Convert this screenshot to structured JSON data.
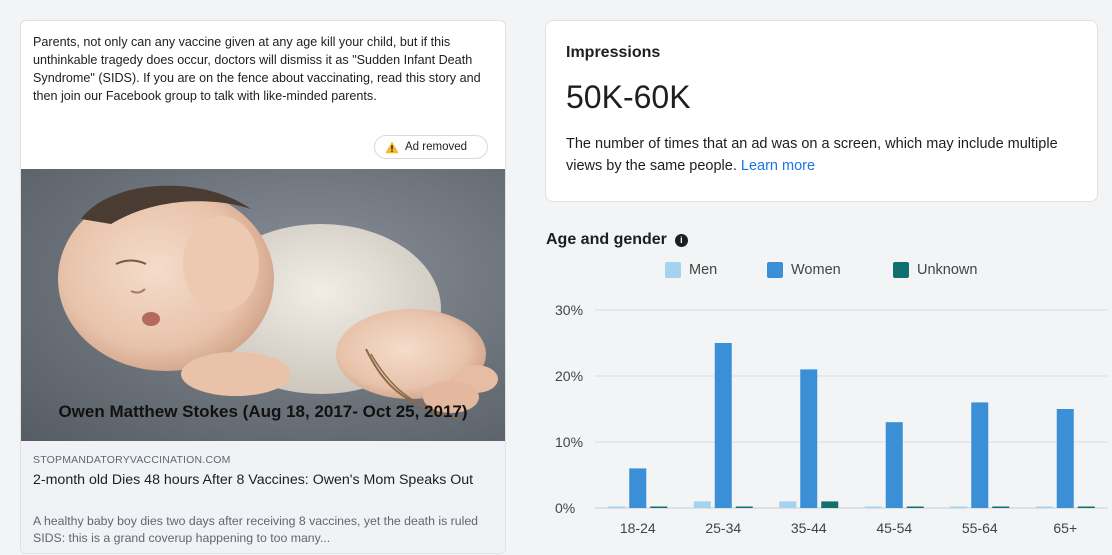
{
  "ad": {
    "body_text": "Parents, not only can any vaccine given at any age kill your child, but if this unthinkable tragedy does occur, doctors will dismiss it as \"Sudden Infant Death Syndrome\" (SIDS). If you are on the fence about vaccinating, read this story and then join our Facebook group to talk with like-minded parents.",
    "removed_badge": "Ad removed",
    "image_caption": "Owen Matthew Stokes (Aug 18, 2017- Oct 25, 2017)",
    "link_domain": "STOPMANDATORYVACCINATION.COM",
    "link_headline": "2-month old Dies 48 hours After 8 Vaccines: Owen's Mom Speaks Out",
    "link_description": "A healthy baby boy dies two days after receiving 8 vaccines, yet the death is ruled SIDS: this is a grand coverup happening to too many..."
  },
  "impressions": {
    "title": "Impressions",
    "value": "50K-60K",
    "description": "The number of times that an ad was on a screen, which may include multiple views by the same people.",
    "learn_more": "Learn more"
  },
  "age_gender": {
    "title": "Age and gender"
  },
  "colors": {
    "men": "#a3d3f0",
    "women": "#3a8fd6",
    "unknown": "#107070",
    "accent_link": "#1b74e4"
  },
  "chart_data": {
    "type": "bar",
    "categories": [
      "18-24",
      "25-34",
      "35-44",
      "45-54",
      "55-64",
      "65+"
    ],
    "series": [
      {
        "name": "Men",
        "values": [
          0.1,
          1,
          1,
          0.1,
          0.1,
          0.1
        ]
      },
      {
        "name": "Women",
        "values": [
          6,
          25,
          21,
          13,
          16,
          15
        ]
      },
      {
        "name": "Unknown",
        "values": [
          0.2,
          0.2,
          1,
          0.2,
          0.2,
          0.2
        ]
      }
    ],
    "yticks": [
      "0%",
      "10%",
      "20%",
      "30%"
    ],
    "ylim": [
      0,
      30
    ],
    "grid": true,
    "legend": "top"
  }
}
